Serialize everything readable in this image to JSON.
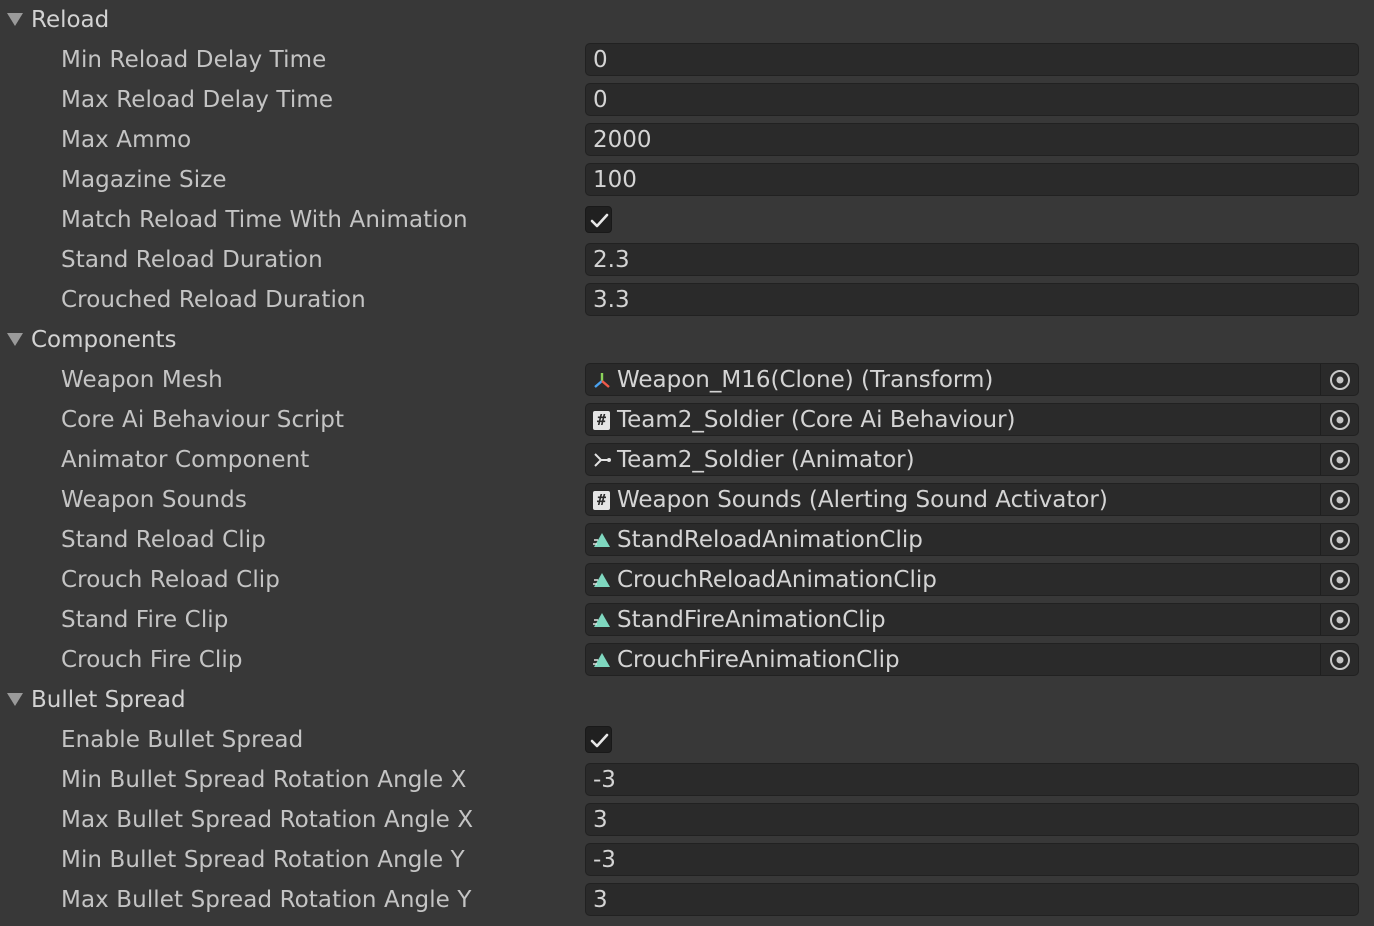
{
  "sections": [
    {
      "title": "Reload",
      "properties": [
        {
          "label": "Min Reload Delay Time",
          "type": "number",
          "value": "0"
        },
        {
          "label": "Max Reload Delay Time",
          "type": "number",
          "value": "0"
        },
        {
          "label": "Max Ammo",
          "type": "number",
          "value": "2000"
        },
        {
          "label": "Magazine Size",
          "type": "number",
          "value": "100"
        },
        {
          "label": "Match Reload Time With Animation",
          "type": "checkbox",
          "checked": true
        },
        {
          "label": "Stand Reload Duration",
          "type": "number",
          "value": "2.3"
        },
        {
          "label": "Crouched Reload Duration",
          "type": "number",
          "value": "3.3"
        }
      ]
    },
    {
      "title": "Components",
      "properties": [
        {
          "label": "Weapon Mesh",
          "type": "object",
          "icon": "transform-icon",
          "value": "Weapon_M16(Clone) (Transform)"
        },
        {
          "label": "Core Ai Behaviour Script",
          "type": "object",
          "icon": "script-icon",
          "value": "Team2_Soldier (Core Ai Behaviour)"
        },
        {
          "label": "Animator Component",
          "type": "object",
          "icon": "animator-icon",
          "value": "Team2_Soldier (Animator)"
        },
        {
          "label": "Weapon Sounds",
          "type": "object",
          "icon": "script-icon",
          "value": "Weapon Sounds (Alerting Sound Activator)"
        },
        {
          "label": "Stand Reload Clip",
          "type": "object",
          "icon": "animation-clip-icon",
          "value": "StandReloadAnimationClip"
        },
        {
          "label": "Crouch Reload Clip",
          "type": "object",
          "icon": "animation-clip-icon",
          "value": "CrouchReloadAnimationClip"
        },
        {
          "label": "Stand Fire Clip",
          "type": "object",
          "icon": "animation-clip-icon",
          "value": "StandFireAnimationClip"
        },
        {
          "label": "Crouch Fire Clip",
          "type": "object",
          "icon": "animation-clip-icon",
          "value": "CrouchFireAnimationClip"
        }
      ]
    },
    {
      "title": "Bullet Spread",
      "properties": [
        {
          "label": "Enable Bullet Spread",
          "type": "checkbox",
          "checked": true
        },
        {
          "label": "Min Bullet Spread Rotation Angle X",
          "type": "number",
          "value": "-3"
        },
        {
          "label": "Max Bullet Spread Rotation Angle X",
          "type": "number",
          "value": "3"
        },
        {
          "label": "Min Bullet Spread Rotation Angle Y",
          "type": "number",
          "value": "-3"
        },
        {
          "label": "Max Bullet Spread Rotation Angle Y",
          "type": "number",
          "value": "3"
        }
      ]
    }
  ],
  "icons": {
    "foldout": "triangle-down-icon",
    "picker": "object-picker-icon",
    "check": "checkmark-icon"
  },
  "colors": {
    "background": "#383838",
    "field": "#2a2a2a",
    "text": "#c4c4c4",
    "clip_icon": "#7fd8c0"
  }
}
